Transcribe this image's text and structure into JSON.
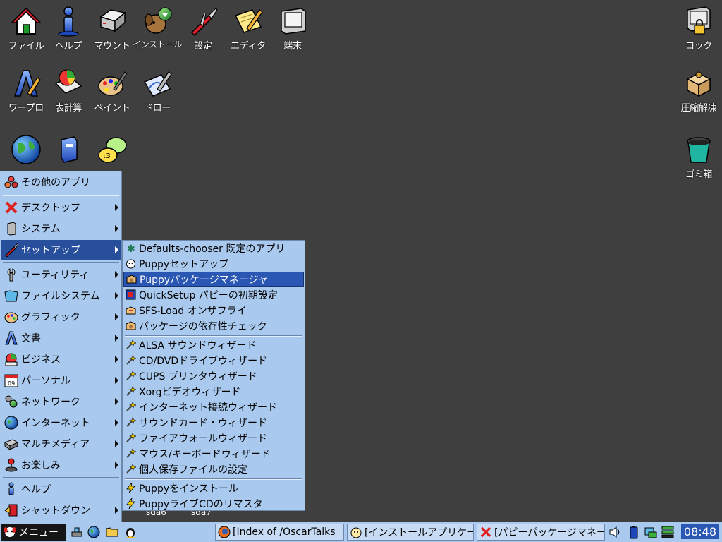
{
  "desktop": {
    "icons": [
      {
        "label": "ファイル"
      },
      {
        "label": "ヘルプ"
      },
      {
        "label": "マウント"
      },
      {
        "label": "インストール"
      },
      {
        "label": "設定"
      },
      {
        "label": "エディタ"
      },
      {
        "label": "端末"
      },
      {
        "label": "ワープロ"
      },
      {
        "label": "表計算"
      },
      {
        "label": "ペイント"
      },
      {
        "label": "ドロー"
      },
      {
        "label": "ロック"
      },
      {
        "label": "圧縮解凍"
      },
      {
        "label": "ゴミ箱"
      }
    ],
    "drives": [
      "sda6",
      "sda7"
    ]
  },
  "menu": {
    "items": [
      {
        "label": "その他のアプリ"
      },
      {
        "label": "デスクトップ"
      },
      {
        "label": "システム"
      },
      {
        "label": "セットアップ"
      },
      {
        "label": "ユーティリティ"
      },
      {
        "label": "ファイルシステム"
      },
      {
        "label": "グラフィック"
      },
      {
        "label": "文書"
      },
      {
        "label": "ビジネス"
      },
      {
        "label": "パーソナル"
      },
      {
        "label": "ネットワーク"
      },
      {
        "label": "インターネット"
      },
      {
        "label": "マルチメディア"
      },
      {
        "label": "お楽しみ"
      },
      {
        "label": "ヘルプ"
      },
      {
        "label": "シャットダウン"
      }
    ],
    "calendar_day": "09"
  },
  "submenu": {
    "items": [
      {
        "label": "Defaults-chooser 既定のアプリ"
      },
      {
        "label": "Puppyセットアップ"
      },
      {
        "label": "Puppyパッケージマネージャ"
      },
      {
        "label": "QuickSetup パピーの初期設定"
      },
      {
        "label": "SFS-Load オンザフライ"
      },
      {
        "label": "パッケージの依存性チェック"
      },
      {
        "label": "ALSA サウンドウィザード"
      },
      {
        "label": "CD/DVDドライブウィザード"
      },
      {
        "label": "CUPS プリンタウィザード"
      },
      {
        "label": "Xorgビデオウィザード"
      },
      {
        "label": "インターネット接続ウィザード"
      },
      {
        "label": "サウンドカード・ウィザード"
      },
      {
        "label": "ファイアウォールウィザード"
      },
      {
        "label": "マウス/キーボードウィザード"
      },
      {
        "label": "個人保存ファイルの設定"
      },
      {
        "label": "Puppyをインストール"
      },
      {
        "label": "PuppyライブCDのリマスタ"
      }
    ]
  },
  "taskbar": {
    "start_label": "メニュー",
    "tasks": [
      {
        "label": "[Index of /OscarTalks"
      },
      {
        "label": "[インストールアプリケー"
      },
      {
        "label": "[パピーパッケージマネー"
      }
    ],
    "clock": "08:48"
  },
  "colors": {
    "desktop": "#3f3f3f",
    "menu_bg": "#a9c9ee",
    "highlight": "#2a57b4"
  }
}
